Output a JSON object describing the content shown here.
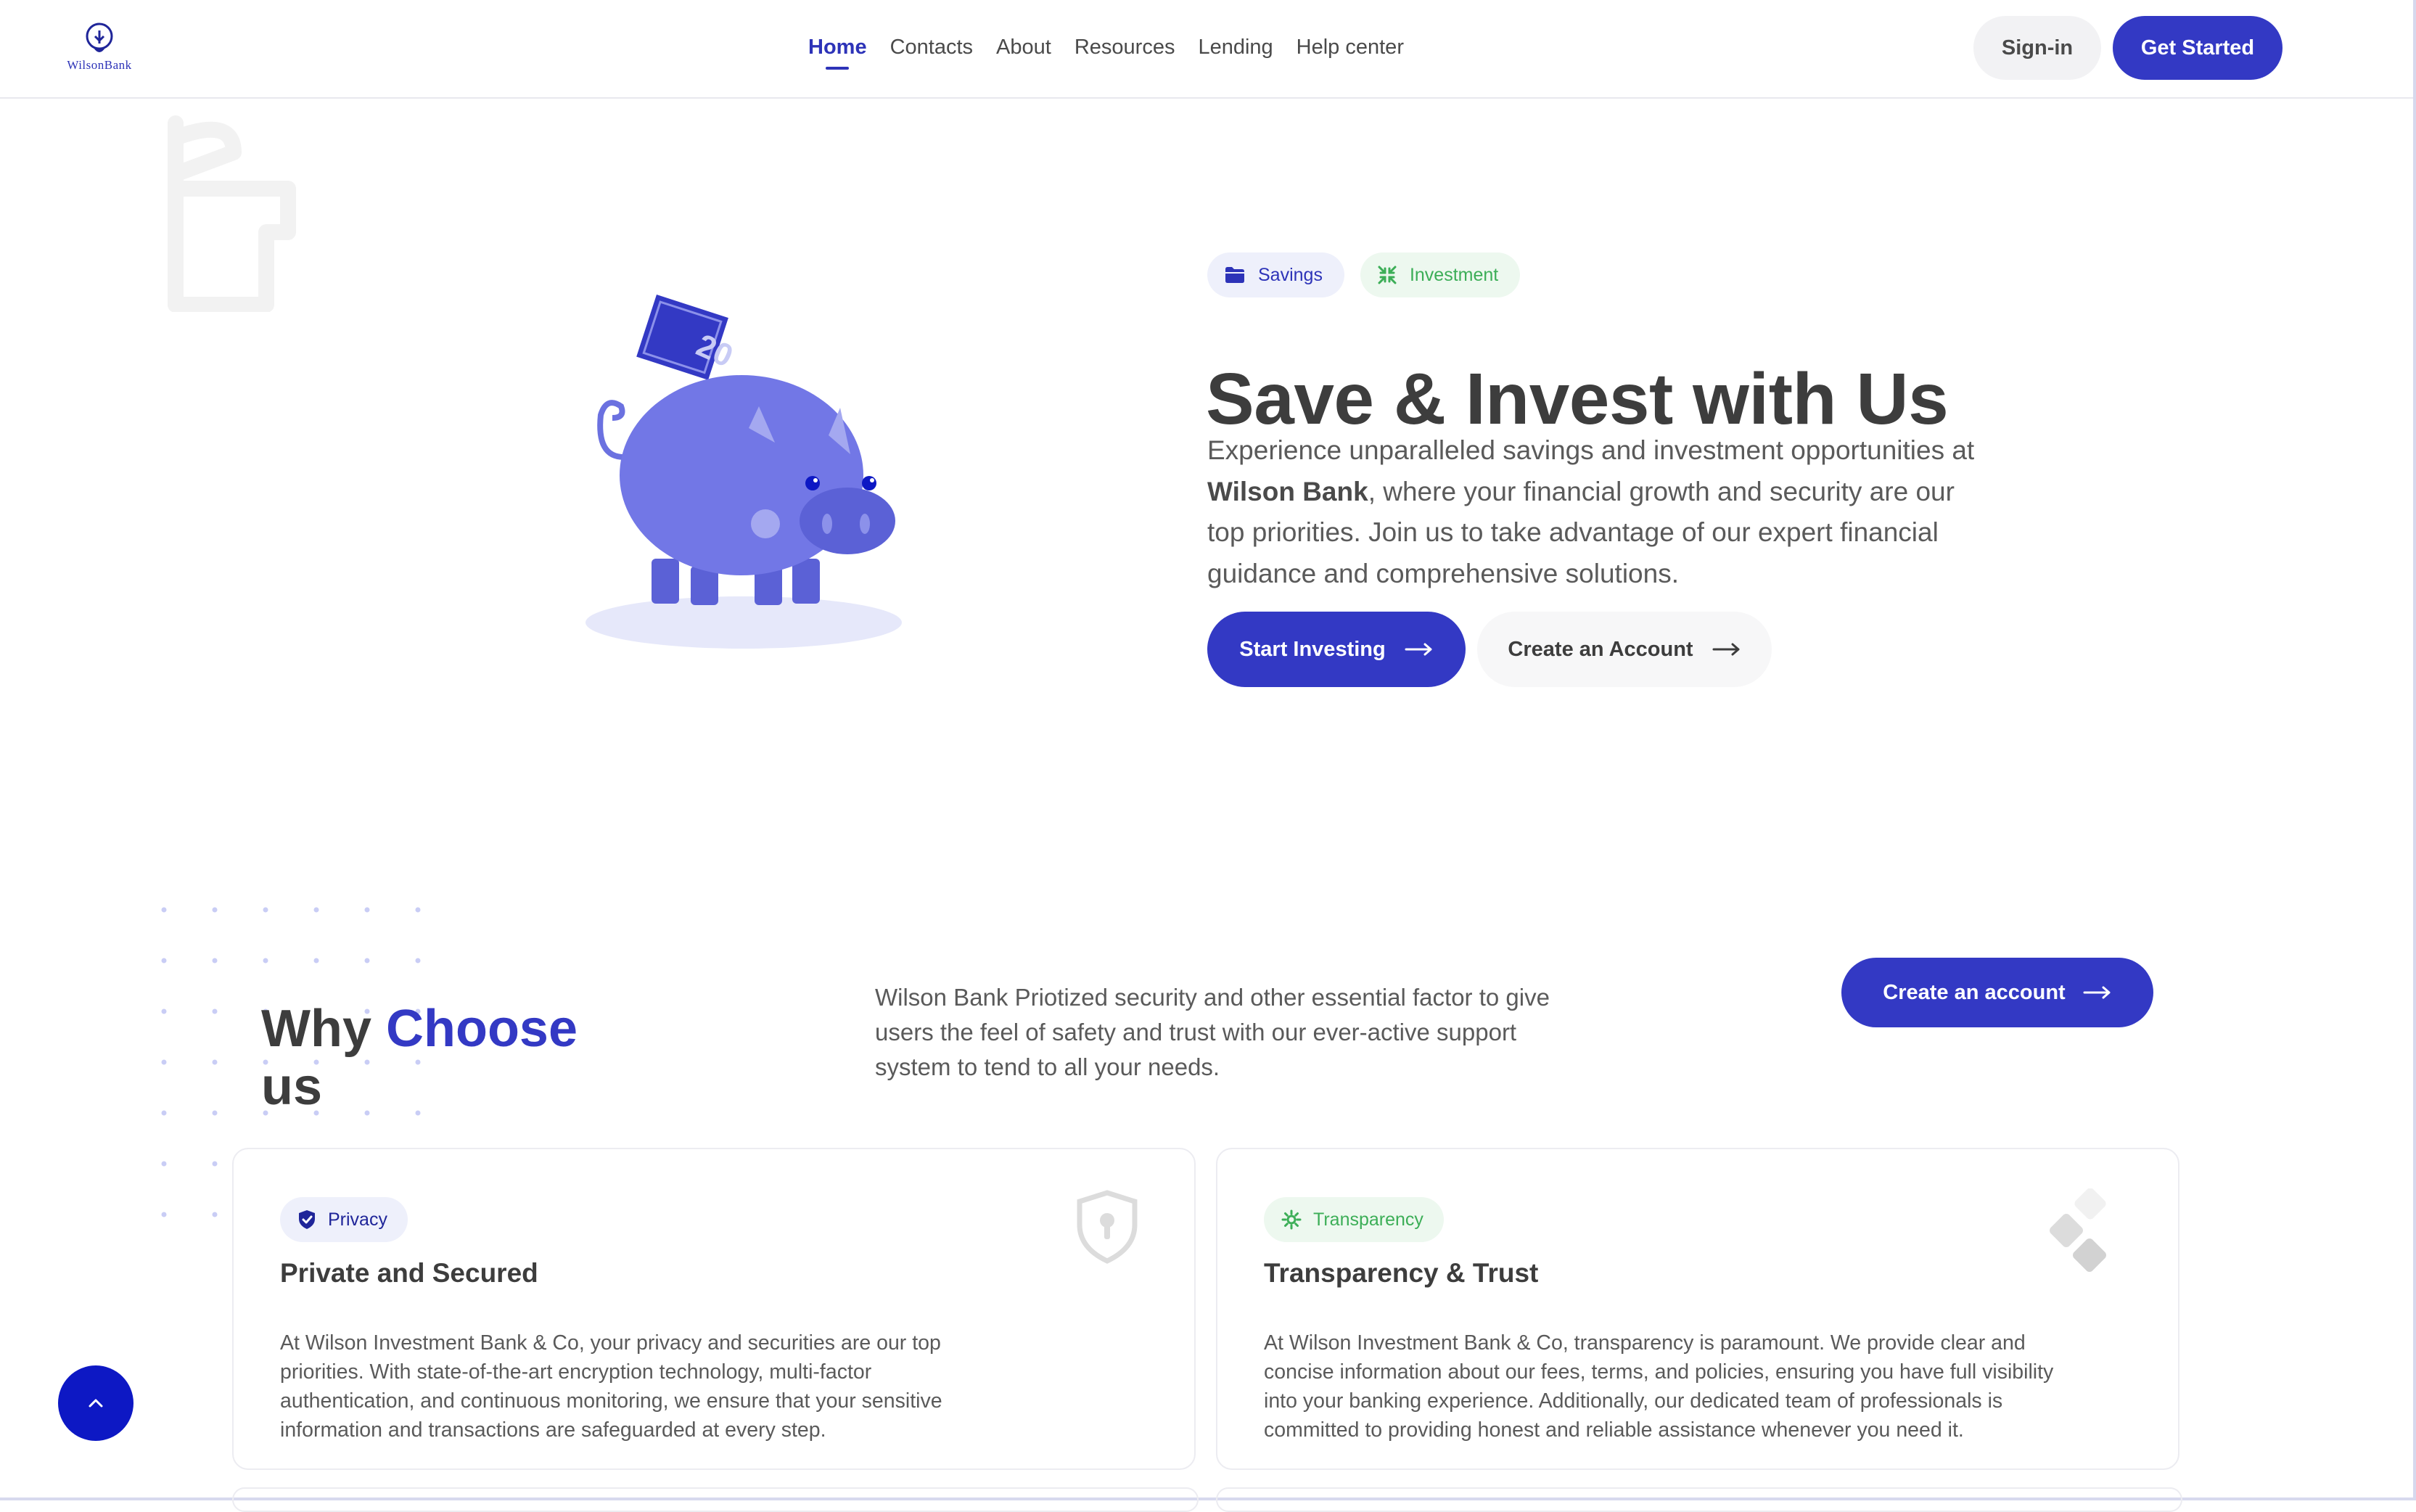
{
  "brand": {
    "logo_text": "WilsonBank",
    "accent_color": "#3339c4",
    "green_color": "#3cae57"
  },
  "nav": {
    "links": [
      {
        "label": "Home",
        "active": true
      },
      {
        "label": "Contacts"
      },
      {
        "label": "About"
      },
      {
        "label": "Resources"
      },
      {
        "label": "Lending"
      },
      {
        "label": "Help center"
      }
    ],
    "signin_label": "Sign-in",
    "get_started_label": "Get Started"
  },
  "hero": {
    "chips": [
      {
        "label": "Savings",
        "icon": "folder-icon"
      },
      {
        "label": "Investment",
        "icon": "compress-icon"
      }
    ],
    "banknote_value": "20",
    "title": "Save & Invest with Us",
    "desc_before": "Experience unparalleled savings and investment opportunities at ",
    "desc_bold": "Wilson Bank",
    "desc_after": ", where your financial growth and security are our top priorities. Join us to take advantage of our expert financial guidance and comprehensive solutions.",
    "primary_label": "Start Investing",
    "secondary_label": "Create an Account"
  },
  "why": {
    "title_part1": "Why ",
    "title_accent": "Choose",
    "title_part2": "us",
    "desc": "Wilson Bank Priotized security and other essential factor to give users the feel of safety and trust with our ever-active support system to tend to all your needs.",
    "button_label": "Create an account"
  },
  "cards": [
    {
      "chip": "Privacy",
      "chip_icon": "shield-check-icon",
      "title": "Private and Secured",
      "desc": "At Wilson Investment Bank & Co, your privacy and securities are our top priorities. With state-of-the-art encryption technology, multi-factor authentication, and continuous monitoring, we ensure that your sensitive information and transactions are safeguarded at every step.",
      "illustration": "shield-lock-icon"
    },
    {
      "chip": "Transparency",
      "chip_icon": "gear-icon",
      "title": "Transparency & Trust",
      "desc": "At Wilson Investment Bank & Co, transparency is paramount. We provide clear and concise information about our fees, terms, and policies, ensuring you have full visibility into your banking experience. Additionally, our dedicated team of professionals is committed to providing honest and reliable assistance whenever you need it.",
      "illustration": "diamonds-icon"
    }
  ],
  "scroll_top_icon": "chevron-up-icon"
}
